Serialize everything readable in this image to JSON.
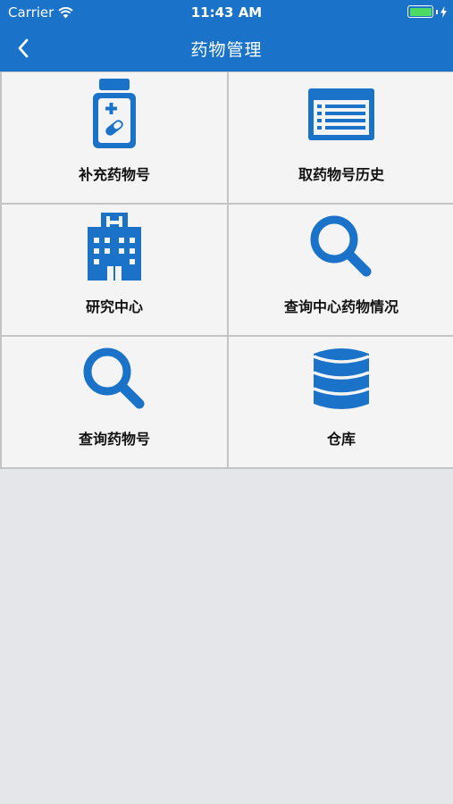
{
  "status_bar": {
    "carrier": "Carrier",
    "time": "11:43 AM"
  },
  "nav": {
    "title": "药物管理",
    "back_icon": "chevron-left-icon"
  },
  "colors": {
    "header": "#1a73c8",
    "icon": "#1a73c8",
    "background": "#e5e6ea",
    "battery": "#4cd964"
  },
  "grid": {
    "items": [
      {
        "label": "补充药物号",
        "icon": "medicine-bottle-icon"
      },
      {
        "label": "取药物号历史",
        "icon": "list-icon"
      },
      {
        "label": "研究中心",
        "icon": "hospital-icon"
      },
      {
        "label": "查询中心药物情况",
        "icon": "search-icon"
      },
      {
        "label": "查询药物号",
        "icon": "search-icon"
      },
      {
        "label": "仓库",
        "icon": "database-icon"
      }
    ]
  }
}
